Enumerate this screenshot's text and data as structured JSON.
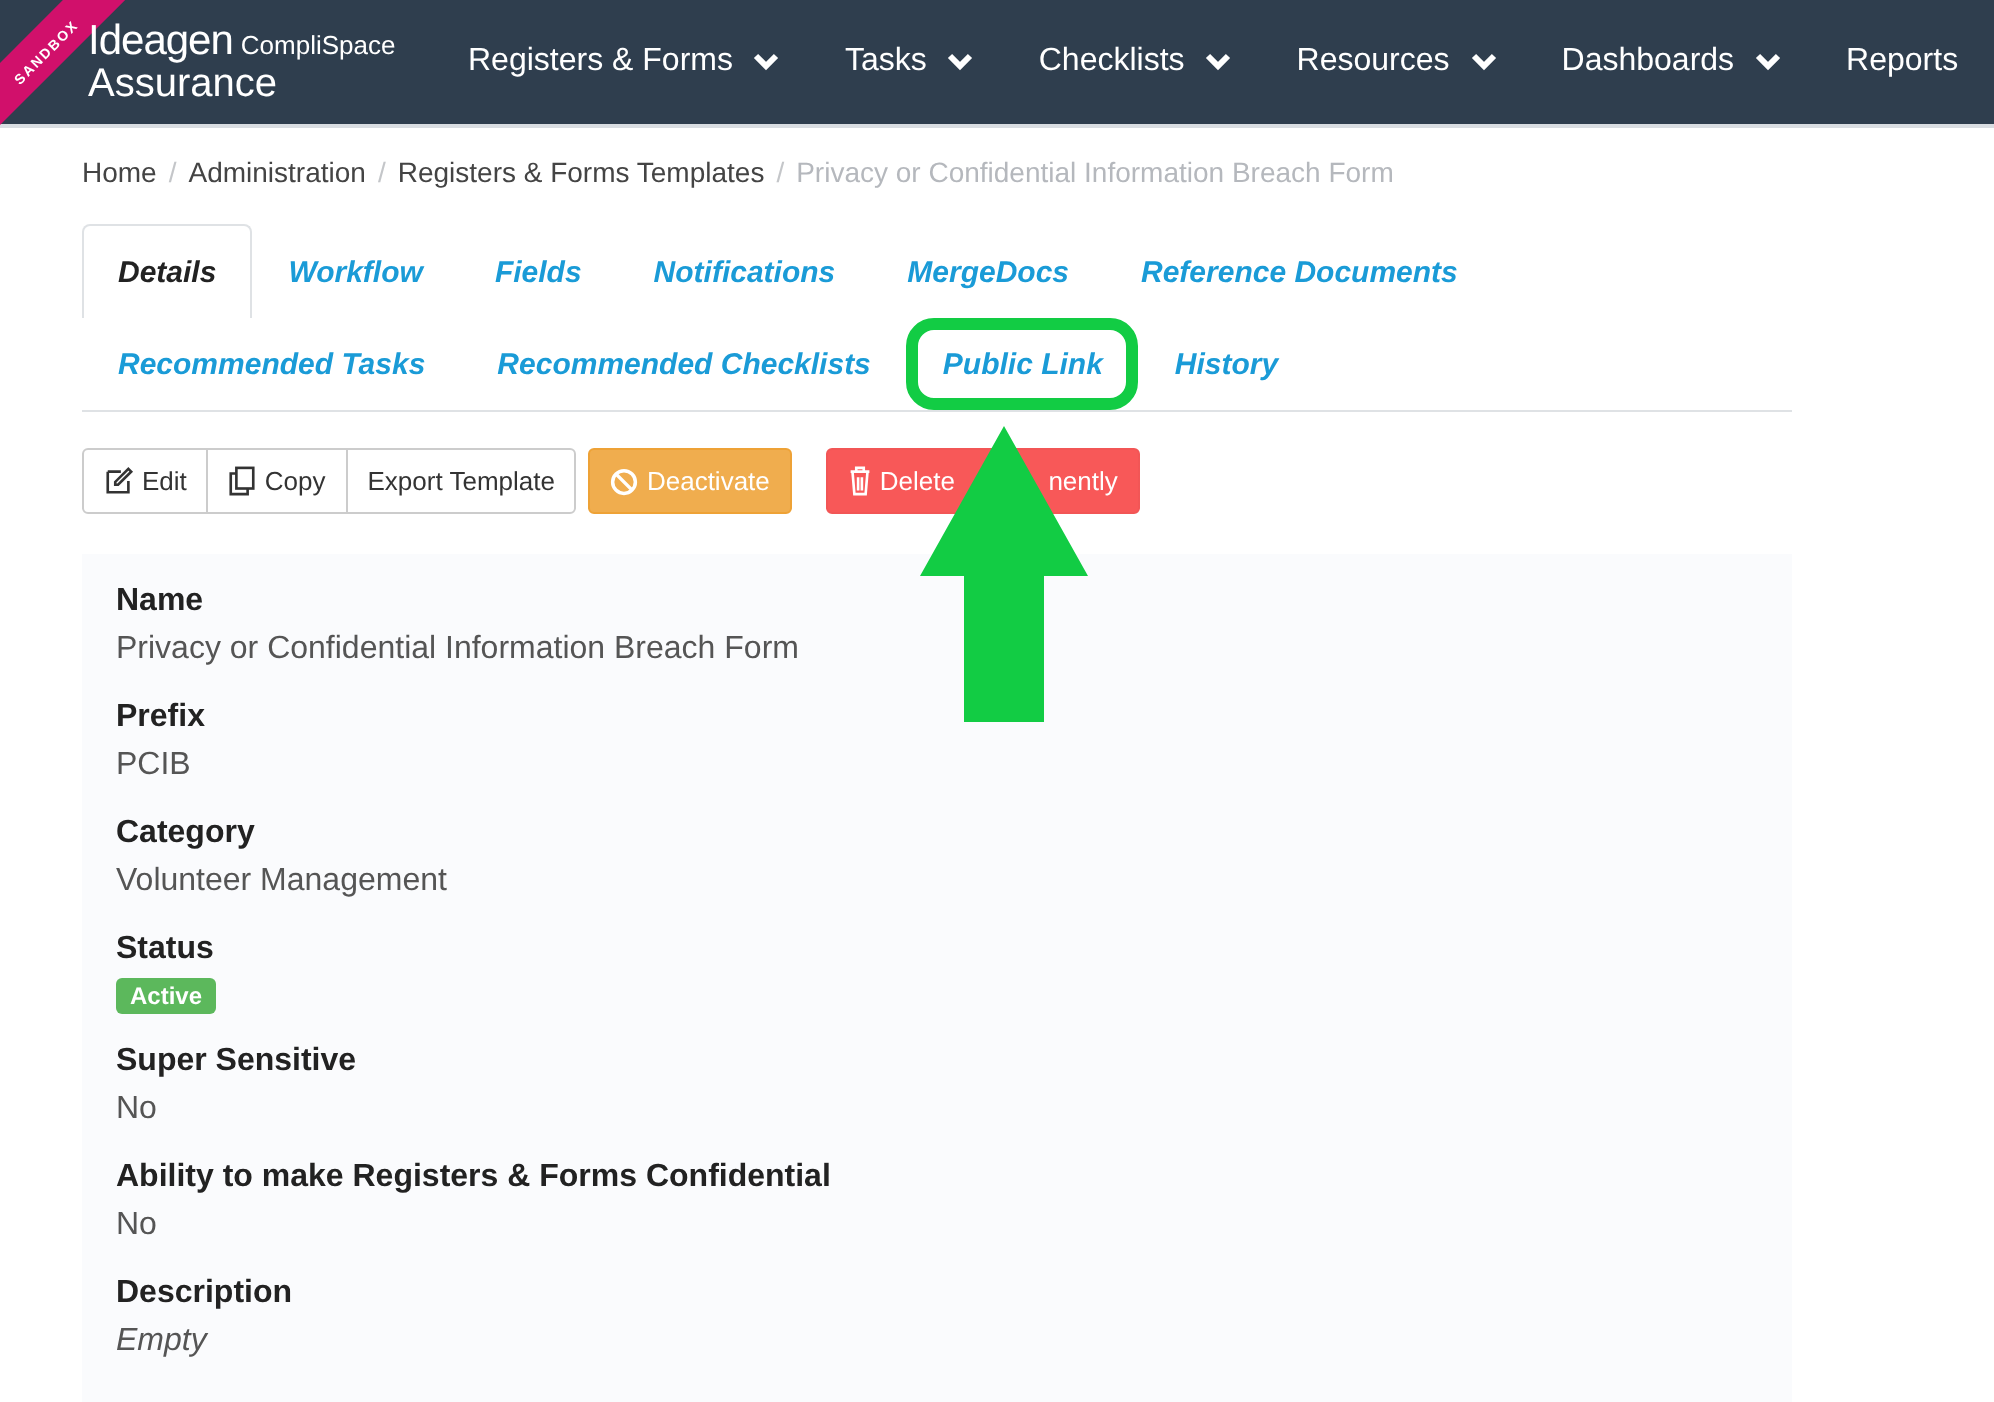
{
  "environment_ribbon": "SANDBOX",
  "logo": {
    "brand": "Ideagen",
    "sub_brand": "CompliSpace",
    "product": "Assurance"
  },
  "nav": [
    {
      "label": "Registers & Forms",
      "dropdown": true
    },
    {
      "label": "Tasks",
      "dropdown": true
    },
    {
      "label": "Checklists",
      "dropdown": true
    },
    {
      "label": "Resources",
      "dropdown": true
    },
    {
      "label": "Dashboards",
      "dropdown": true
    },
    {
      "label": "Reports",
      "dropdown": false
    }
  ],
  "breadcrumb": [
    {
      "label": "Home",
      "current": false,
      "separator": "/"
    },
    {
      "label": "Administration",
      "current": false,
      "separator": "/"
    },
    {
      "label": "Registers & Forms Templates",
      "current": false,
      "separator": "/"
    },
    {
      "label": "Privacy or Confidential Information Breach Form",
      "current": true
    }
  ],
  "tab_rows": [
    [
      {
        "label": "Details",
        "selected": true,
        "highlighted": false
      },
      {
        "label": "Workflow",
        "selected": false,
        "highlighted": false
      },
      {
        "label": "Fields",
        "selected": false,
        "highlighted": false
      },
      {
        "label": "Notifications",
        "selected": false,
        "highlighted": false
      },
      {
        "label": "MergeDocs",
        "selected": false,
        "highlighted": false
      },
      {
        "label": "Reference Documents",
        "selected": false,
        "highlighted": false
      }
    ],
    [
      {
        "label": "Recommended Tasks",
        "selected": false,
        "highlighted": false
      },
      {
        "label": "Recommended Checklists",
        "selected": false,
        "highlighted": false
      },
      {
        "label": "Public Link",
        "selected": false,
        "highlighted": true
      },
      {
        "label": "History",
        "selected": false,
        "highlighted": false
      }
    ]
  ],
  "toolbar": [
    {
      "kind": "edit",
      "label": "Edit"
    },
    {
      "kind": "copy",
      "label": "Copy"
    },
    {
      "kind": "plain",
      "label": "Export Template"
    },
    {
      "kind": "deactivate",
      "label": "Deactivate"
    },
    {
      "kind": "delete",
      "label": "Delete",
      "label_end": "nently"
    }
  ],
  "details": [
    {
      "label": "Name",
      "kind": "text",
      "value": "Privacy or Confidential Information Breach Form"
    },
    {
      "label": "Prefix",
      "kind": "text",
      "value": "PCIB"
    },
    {
      "label": "Category",
      "kind": "text",
      "value": "Volunteer Management"
    },
    {
      "label": "Status",
      "kind": "badge",
      "value": "Active",
      "color": "#5cb85c"
    },
    {
      "label": "Super Sensitive",
      "kind": "text",
      "value": "No"
    },
    {
      "label": "Ability to make Registers & Forms Confidential",
      "kind": "text",
      "value": "No"
    },
    {
      "label": "Description",
      "kind": "empty",
      "value": "Empty"
    }
  ],
  "annotation": {
    "kind": "up-arrow",
    "color": "#12cc44"
  }
}
